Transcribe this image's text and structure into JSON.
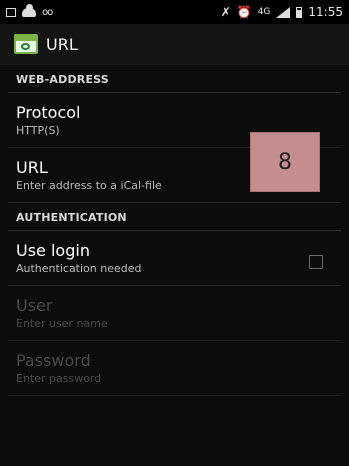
{
  "status_bar": {
    "voicemail": "oo",
    "network": "4G",
    "time": "11:55"
  },
  "action_bar": {
    "title": "URL"
  },
  "sections": {
    "web_address": "WEB-ADDRESS",
    "authentication": "AUTHENTICATION"
  },
  "prefs": {
    "protocol": {
      "title": "Protocol",
      "summary": "HTTP(S)"
    },
    "url": {
      "title": "URL",
      "summary": "Enter address to a iCal-file"
    },
    "use_login": {
      "title": "Use login",
      "summary": "Authentication needed",
      "checked": false
    },
    "user": {
      "title": "User",
      "summary": "Enter user name"
    },
    "password": {
      "title": "Password",
      "summary": "Enter password"
    }
  },
  "overlay_badge": "8"
}
